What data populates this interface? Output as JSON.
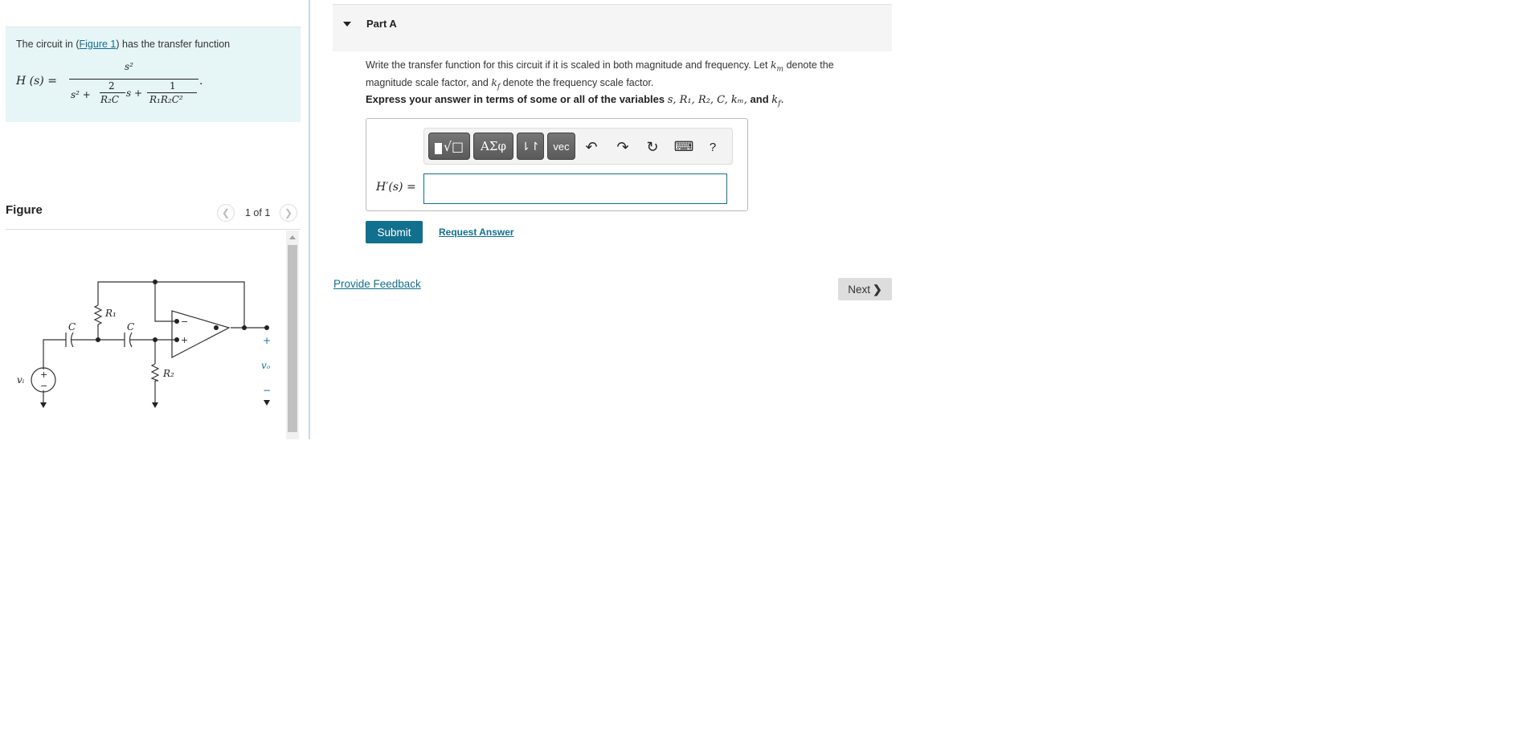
{
  "intro": {
    "prefix": "The circuit in (",
    "figure_link": "Figure 1",
    "suffix": ") has the transfer function",
    "equation": {
      "lhs": "H (s) =",
      "numerator": "s²",
      "denominator_terms": [
        "s² +",
        "2",
        "R₂C",
        "s +",
        "1",
        "R₁R₂C²"
      ],
      "trailing": "."
    }
  },
  "figure": {
    "title": "Figure",
    "page_count": "1 of 1",
    "prev_icon": "chevron-left-icon",
    "next_icon": "chevron-right-icon",
    "labels": {
      "R1": "R₁",
      "R2": "R₂",
      "C1": "C",
      "C2": "C",
      "vi": "vᵢ",
      "vo": "vₒ",
      "plus": "+",
      "minus": "−"
    },
    "wire_color": "#333333",
    "output_label_color": "#1b6f93"
  },
  "part": {
    "title": "Part A",
    "question_a": "Write the transfer function for this circuit if it is scaled in both magnitude and frequency. Let ",
    "km": "k",
    "km_sub": "m",
    "question_b": " denote the magnitude scale factor, and ",
    "kf": "k",
    "kf_sub": "f",
    "question_c": " denote the frequency scale factor.",
    "express_prefix": "Express your answer in terms of some or all of the variables ",
    "express_vars": "s, R₁, R₂, C, kₘ,",
    "express_and": " and ",
    "express_last": "k",
    "express_last_sub": "f",
    "express_end": "."
  },
  "toolbar": {
    "buttons": [
      {
        "name": "templates",
        "label": "■∜□"
      },
      {
        "name": "greek",
        "label": "ΑΣφ"
      },
      {
        "name": "arrows",
        "label": "⇂↾"
      },
      {
        "name": "vector",
        "label": "vec"
      }
    ],
    "icons": [
      {
        "name": "undo-icon",
        "glyph": "↶"
      },
      {
        "name": "redo-icon",
        "glyph": "↷"
      },
      {
        "name": "reset-icon",
        "glyph": "↻"
      },
      {
        "name": "keyboard-icon",
        "glyph": "⌨"
      },
      {
        "name": "help-icon",
        "glyph": "?"
      }
    ]
  },
  "answer": {
    "label": "H′(s) =",
    "value": ""
  },
  "actions": {
    "submit": "Submit",
    "request_answer": "Request Answer",
    "provide_feedback": "Provide Feedback",
    "next": "Next",
    "next_icon": "❯"
  },
  "colors": {
    "accent": "#10708e",
    "intro_bg": "#e6f5f6",
    "header_bg": "#f5f5f5"
  }
}
